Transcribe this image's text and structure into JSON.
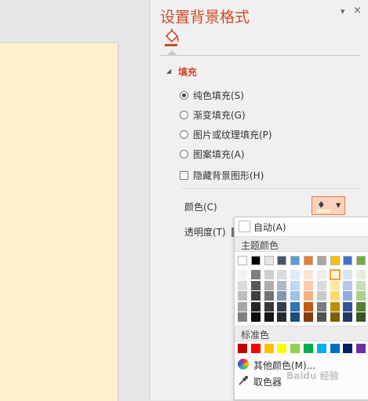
{
  "pane": {
    "title": "设置背景格式",
    "pin_label": "▾",
    "close_label": "×"
  },
  "section": {
    "title": "填充",
    "expanded_icon": "triangle-expanded-icon"
  },
  "fill_options": [
    {
      "label": "纯色填充(S)",
      "selected": true
    },
    {
      "label": "渐变填充(G)",
      "selected": false
    },
    {
      "label": "图片或纹理填充(P)",
      "selected": false
    },
    {
      "label": "图案填充(A)",
      "selected": false
    }
  ],
  "hide_background": {
    "label": "隐藏背景图形(H)",
    "checked": false
  },
  "color": {
    "label": "颜色(C)",
    "current": "#fff0cc"
  },
  "transparency": {
    "label": "透明度(T)"
  },
  "dropdown": {
    "auto_label": "自动(A)",
    "theme_header": "主题颜色",
    "standard_header": "标准色",
    "more_colors_label": "其他颜色(M)...",
    "eyedropper_label": "取色器",
    "theme_top": [
      "#ffffff",
      "#000000",
      "#e7e6e6",
      "#44546a",
      "#5b9bd5",
      "#ed7d31",
      "#a5a5a5",
      "#ffc000",
      "#4472c4",
      "#70ad47"
    ],
    "theme_shades": [
      [
        "#f2f2f2",
        "#d9d9d9",
        "#bfbfbf",
        "#a6a6a6",
        "#808080"
      ],
      [
        "#7f7f7f",
        "#595959",
        "#3f3f3f",
        "#262626",
        "#0d0d0d"
      ],
      [
        "#d0cece",
        "#aeabab",
        "#757171",
        "#3a3838",
        "#171616"
      ],
      [
        "#d6dce5",
        "#adb9ca",
        "#8497b0",
        "#333f50",
        "#222a35"
      ],
      [
        "#deebf7",
        "#bdd7ee",
        "#9dc3e6",
        "#2e75b6",
        "#1f4e79"
      ],
      [
        "#fbe5d6",
        "#f8cbad",
        "#f4b183",
        "#c55a11",
        "#843c0c"
      ],
      [
        "#ededed",
        "#dbdbdb",
        "#c9c9c9",
        "#7b7b7b",
        "#525252"
      ],
      [
        "#fff2cc",
        "#ffe699",
        "#ffd966",
        "#bf9000",
        "#7f6000"
      ],
      [
        "#dae3f3",
        "#b4c7e7",
        "#8faadc",
        "#2f5597",
        "#203864"
      ],
      [
        "#e2f0d9",
        "#c5e0b4",
        "#a9d18e",
        "#548235",
        "#385723"
      ]
    ],
    "selected_shade": {
      "col": 7,
      "row": 0
    },
    "standard": [
      "#c00000",
      "#ff0000",
      "#ffc000",
      "#ffff00",
      "#92d050",
      "#00b050",
      "#00b0f0",
      "#0070c0",
      "#002060",
      "#7030a0"
    ]
  },
  "watermark": "Baidu 经验"
}
